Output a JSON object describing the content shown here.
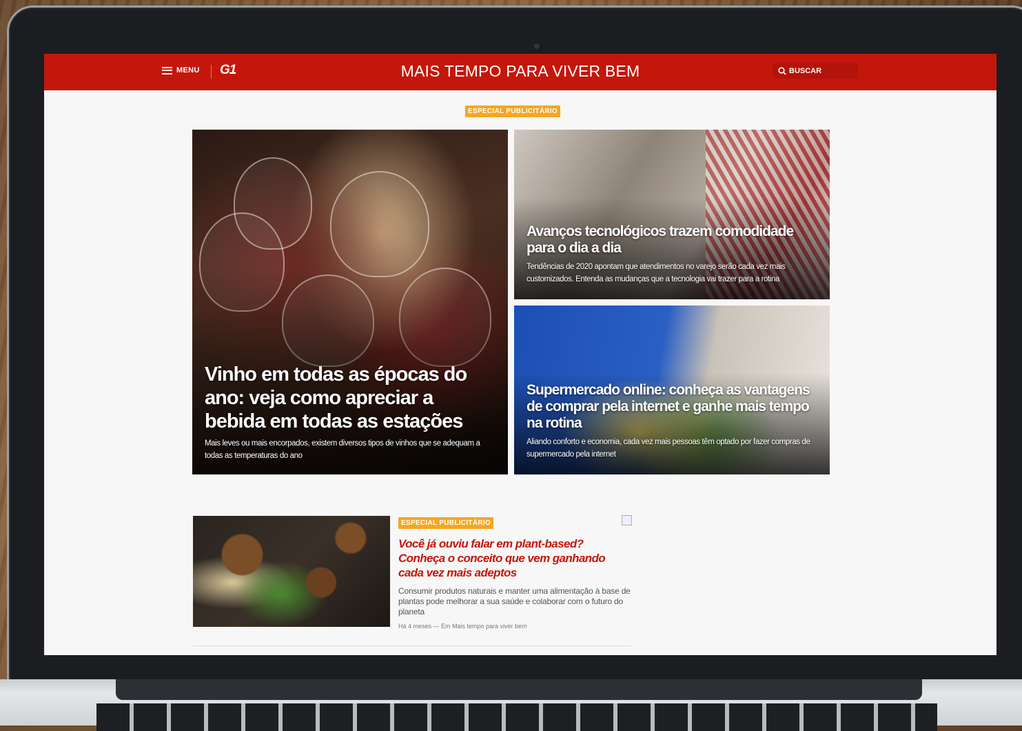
{
  "navbar": {
    "menu_label": "MENU",
    "logo": "G1",
    "site_title": "MAIS TEMPO PARA VIVER BEM",
    "search_label": "BUSCAR",
    "bg_color": "#c4170c"
  },
  "badge_label": "ESPECIAL PUBLICITÁRIO",
  "featured": [
    {
      "title": "Vinho em todas as épocas do ano: veja como apreciar a bebida em todas as estações",
      "summary": "Mais leves ou mais encorpados, existem diversos tipos de vinhos que se adequam a todas as temperaturas do ano"
    },
    {
      "title": "Avanços tecnológicos trazem comodidade para o dia a dia",
      "summary": "Tendências de 2020 apontam que atendimentos no varejo serão cada vez mais customizados. Entenda as mudanças que a tecnologia vai trazer para a rotina"
    },
    {
      "title": "Supermercado online: conheça as vantagens de comprar pela internet e ganhe mais tempo na rotina",
      "summary": "Aliando conforto e economia, cada vez mais pessoas têm optado por fazer compras de supermercado pela internet"
    }
  ],
  "article": {
    "badge": "ESPECIAL PUBLICITÁRIO",
    "title": "Você já ouviu falar em plant-based? Conheça o conceito que vem ganhando cada vez mais adeptos",
    "summary": "Consumir produtos naturais e manter uma alimentação à base de plantas pode melhorar a sua saúde e colaborar com o futuro do planeta",
    "meta": "Há 4 meses — Em Mais tempo para viver bem"
  },
  "colors": {
    "brand_red": "#c4170c",
    "badge_orange": "#f5a623"
  }
}
